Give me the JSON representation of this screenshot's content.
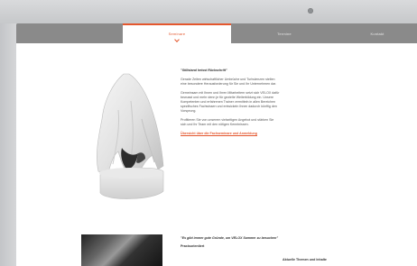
{
  "nav": {
    "tabs": [
      {
        "label": ""
      },
      {
        "label": "Seminare"
      },
      {
        "label": "Termine"
      },
      {
        "label": "Kontakt"
      }
    ]
  },
  "intro": {
    "quote": "\"Stillstand heisst Rückschritt\"",
    "p1": "Gerade Zeiten wirtschaftlicher Umbrüche und Turbulenzen stellen eine besondere Herausforderung für Sie und Ihr Unternehmen dar.",
    "p2": "Gemeinsam mit Ihnen und Ihren Mitarbeitern setzt sich VELOX dafür bewusst und mehr denn je für gezielte Weiterbildung ein. Unsere Kompetenten und erfahrenen Trainer vermitteln in allen Bereichen spezifisches Fachwissen und entwickeln Ihnen dadurch künftig den Vorsprung.",
    "p3": "Profitieren Sie von unserem vielseitigen Angebot und stärken Sie sich und Ihr Team mit den nötigen Kenntnissen.",
    "link": "Übersicht über die Fachseminare und Anmeldung"
  },
  "second": {
    "quote": "\"Es gibt immer gute Gründe, um VELOX Sammer zu besuchen\"",
    "heading": "Praxisorientiert",
    "col3_heading": "Aktuelle Themen und Inhalte"
  },
  "icons": {
    "camera": "camera-dot"
  }
}
